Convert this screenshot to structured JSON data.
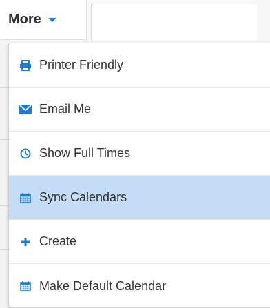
{
  "toolbar": {
    "more_label": "More"
  },
  "menu": {
    "items": [
      {
        "label": "Printer Friendly",
        "icon": "printer-icon"
      },
      {
        "label": "Email Me",
        "icon": "envelope-icon"
      },
      {
        "label": "Show Full Times",
        "icon": "clock-icon"
      },
      {
        "label": "Sync Calendars",
        "icon": "calendar-icon",
        "highlighted": true
      },
      {
        "label": "Create",
        "icon": "plus-icon"
      },
      {
        "label": "Make Default Calendar",
        "icon": "calendar-icon"
      }
    ]
  },
  "colors": {
    "accent": "#1e7bd6",
    "highlight": "#c4dcf5",
    "text": "#333333"
  }
}
